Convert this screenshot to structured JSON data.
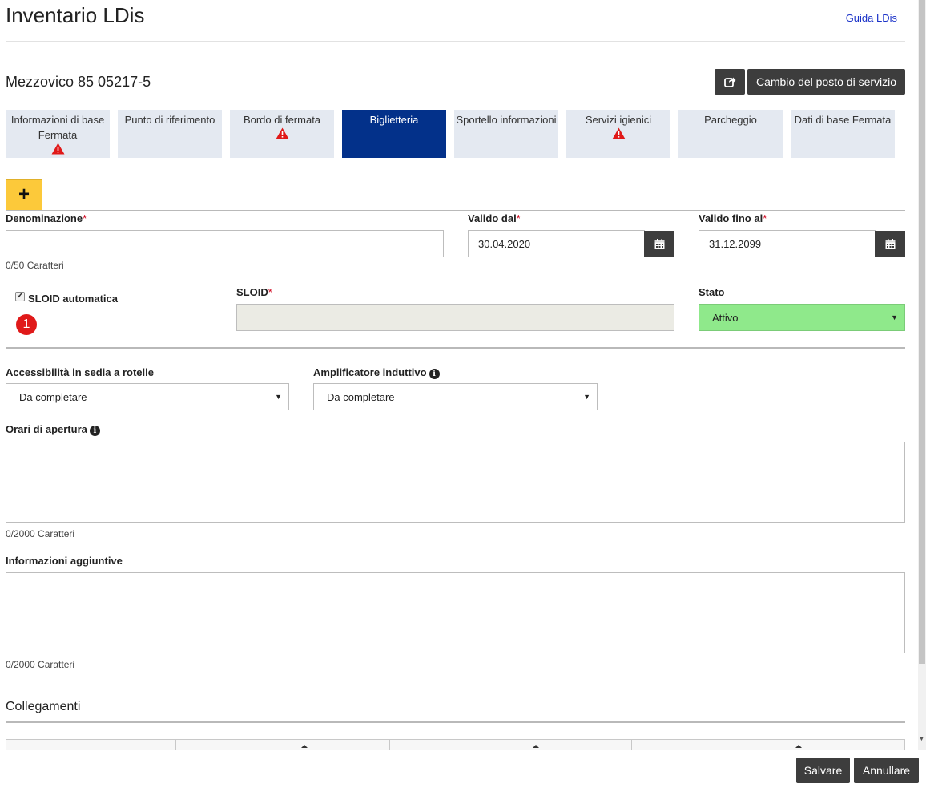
{
  "header": {
    "title": "Inventario LDis",
    "help_link": "Guida LDis"
  },
  "stop": {
    "name": "Mezzovico 85 05217-5",
    "change_button": "Cambio del posto di servizio"
  },
  "tabs": [
    {
      "label": "Informazioni di base Fermata",
      "warning": true,
      "active": false
    },
    {
      "label": "Punto di riferimento",
      "warning": false,
      "active": false
    },
    {
      "label": "Bordo di fermata",
      "warning": true,
      "active": false
    },
    {
      "label": "Biglietteria",
      "warning": false,
      "active": true
    },
    {
      "label": "Sportello informazioni",
      "warning": false,
      "active": false
    },
    {
      "label": "Servizi igienici",
      "warning": true,
      "active": false
    },
    {
      "label": "Parcheggio",
      "warning": false,
      "active": false
    },
    {
      "label": "Dati di base Fermata",
      "warning": false,
      "active": false
    }
  ],
  "add_button": "+",
  "form": {
    "denominazione": {
      "label": "Denominazione",
      "required": "*",
      "value": "",
      "hint": "0/50 Caratteri"
    },
    "valido_dal": {
      "label": "Valido dal",
      "required": "*",
      "value": "30.04.2020"
    },
    "valido_fino": {
      "label": "Valido fino al",
      "required": "*",
      "value": "31.12.2099"
    },
    "sloid_auto": {
      "label": "SLOID automatica",
      "checked": true,
      "badge": "1"
    },
    "sloid": {
      "label": "SLOID",
      "required": "*",
      "value": ""
    },
    "stato": {
      "label": "Stato",
      "value": "Attivo",
      "color": "#8fe98b"
    },
    "accessibilita": {
      "label": "Accessibilità in sedia a rotelle",
      "value": "Da completare"
    },
    "amplificatore": {
      "label": "Amplificatore induttivo",
      "value": "Da completare"
    },
    "orari": {
      "label": "Orari di apertura",
      "hint": "0/2000 Caratteri"
    },
    "informazioni": {
      "label": "Informazioni aggiuntive",
      "hint": "0/2000 Caratteri"
    }
  },
  "links_section": {
    "title": "Collegamenti"
  },
  "footer": {
    "save": "Salvare",
    "cancel": "Annullare"
  },
  "colors": {
    "active_tab": "#03318a",
    "add_button": "#fcc93a",
    "dark_button": "#3d3d3d",
    "tab_bg": "#e4e9f1"
  }
}
